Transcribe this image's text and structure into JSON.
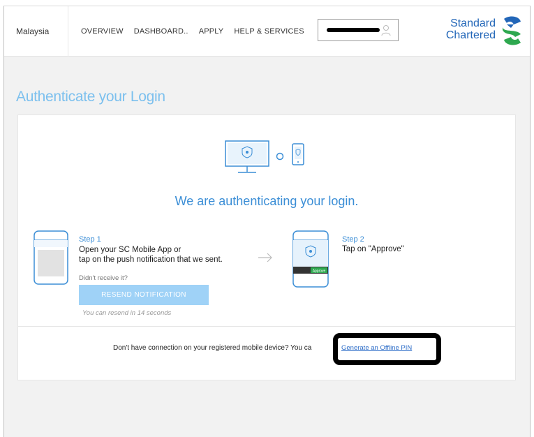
{
  "header": {
    "country": "Malaysia",
    "nav": [
      "OVERVIEW",
      "DASHBOARD..",
      "APPLY",
      "HELP & SERVICES"
    ],
    "logo_line1": "Standard",
    "logo_line2": "Chartered"
  },
  "colors": {
    "brand_blue": "#2266b8",
    "brand_green": "#2ea84f",
    "title_blue": "#7cc0ee",
    "accent_blue": "#3b8ed6",
    "button_blue": "#9fd2f7"
  },
  "page": {
    "title": "Authenticate your Login",
    "heading": "We are authenticating your login."
  },
  "step1": {
    "title": "Step 1",
    "text_line1": "Open your SC Mobile App or",
    "text_line2": "tap on the push notification that we sent.",
    "didnt_receive": "Didn't receive it?",
    "resend_label": "RESEND NOTIFICATION",
    "resend_note": "You can resend in 14 seconds"
  },
  "step2": {
    "title": "Step 2",
    "text": "Tap on \"Approve\"",
    "approve_label": "Approve"
  },
  "footer": {
    "question": "Don't have connection on your registered mobile device? You ca",
    "offline_link": "Generate an Offline PIN"
  },
  "icons": [
    "user-icon",
    "monitor-icon",
    "sync-icon",
    "phone-icon",
    "arrow-right-icon",
    "shield-icon"
  ]
}
